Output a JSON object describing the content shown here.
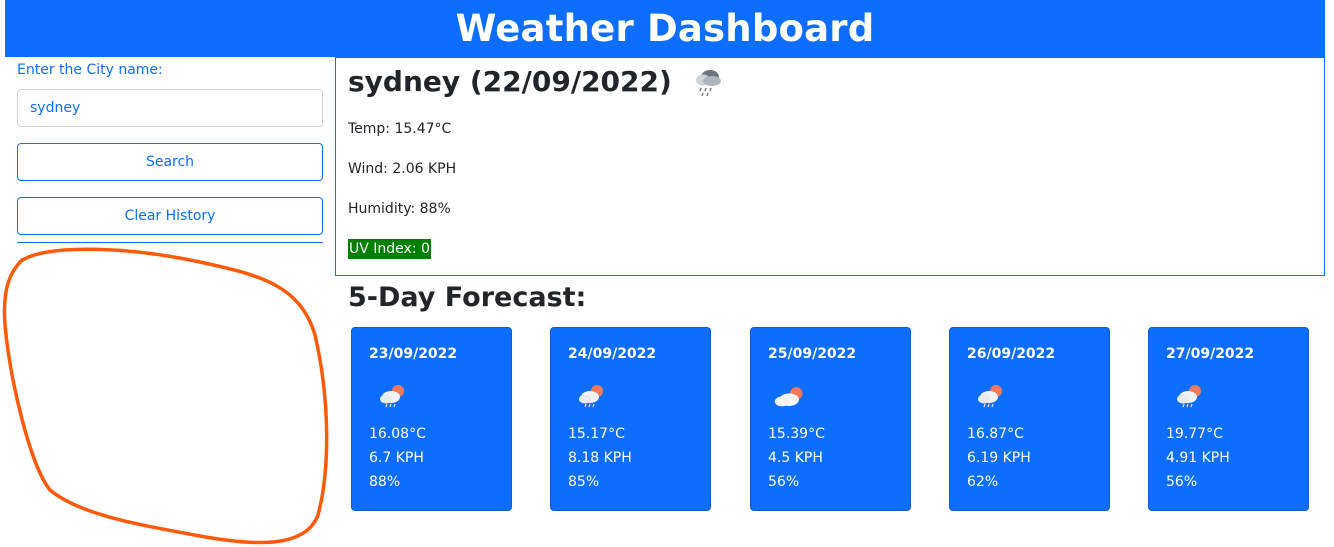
{
  "header": {
    "title": "Weather Dashboard"
  },
  "sidebar": {
    "city_label": "Enter the City name:",
    "city_input_value": "sydney",
    "search_label": "Search",
    "clear_label": "Clear History"
  },
  "current": {
    "title": "sydney (22/09/2022)",
    "icon": "rain-cloud-icon",
    "temp": "Temp: 15.47°C",
    "wind": "Wind: 2.06 KPH",
    "humidity": "Humidity: 88%",
    "uv": "UV Index: 0",
    "uv_color": "#008000"
  },
  "forecast": {
    "title": "5-Day Forecast:",
    "days": [
      {
        "date": "23/09/2022",
        "icon": "sun-rain-cloud-icon",
        "temp": "16.08°C",
        "wind": "6.7 KPH",
        "humidity": "88%"
      },
      {
        "date": "24/09/2022",
        "icon": "sun-rain-cloud-icon",
        "temp": "15.17°C",
        "wind": "8.18 KPH",
        "humidity": "85%"
      },
      {
        "date": "25/09/2022",
        "icon": "sun-cloud-icon",
        "temp": "15.39°C",
        "wind": "4.5 KPH",
        "humidity": "56%"
      },
      {
        "date": "26/09/2022",
        "icon": "sun-rain-cloud-icon",
        "temp": "16.87°C",
        "wind": "6.19 KPH",
        "humidity": "62%"
      },
      {
        "date": "27/09/2022",
        "icon": "sun-rain-cloud-icon",
        "temp": "19.77°C",
        "wind": "4.91 KPH",
        "humidity": "56%"
      }
    ]
  },
  "colors": {
    "accent": "#0d6efd",
    "uv_low": "#008000",
    "annotation": "#ff5a0a"
  }
}
